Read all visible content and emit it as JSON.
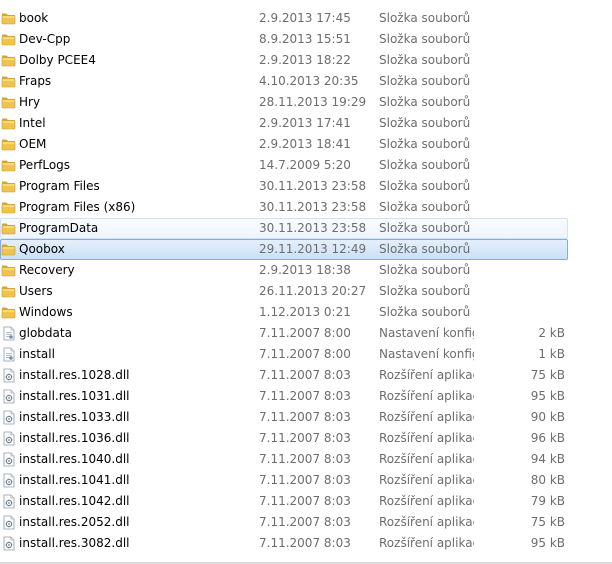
{
  "file_list": {
    "rows": [
      {
        "name": "book",
        "date": "2.9.2013 17:45",
        "type": "Složka souborů",
        "size": "",
        "icon": "folder-icon"
      },
      {
        "name": "Dev-Cpp",
        "date": "8.9.2013 15:51",
        "type": "Složka souborů",
        "size": "",
        "icon": "folder-icon"
      },
      {
        "name": "Dolby PCEE4",
        "date": "2.9.2013 18:22",
        "type": "Složka souborů",
        "size": "",
        "icon": "folder-icon"
      },
      {
        "name": "Fraps",
        "date": "4.10.2013 20:35",
        "type": "Složka souborů",
        "size": "",
        "icon": "folder-icon"
      },
      {
        "name": "Hry",
        "date": "28.11.2013 19:29",
        "type": "Složka souborů",
        "size": "",
        "icon": "folder-icon"
      },
      {
        "name": "Intel",
        "date": "2.9.2013 17:41",
        "type": "Složka souborů",
        "size": "",
        "icon": "folder-icon"
      },
      {
        "name": "OEM",
        "date": "2.9.2013 18:41",
        "type": "Složka souborů",
        "size": "",
        "icon": "folder-icon"
      },
      {
        "name": "PerfLogs",
        "date": "14.7.2009 5:20",
        "type": "Složka souborů",
        "size": "",
        "icon": "folder-icon"
      },
      {
        "name": "Program Files",
        "date": "30.11.2013 23:58",
        "type": "Složka souborů",
        "size": "",
        "icon": "folder-icon"
      },
      {
        "name": "Program Files (x86)",
        "date": "30.11.2013 23:58",
        "type": "Složka souborů",
        "size": "",
        "icon": "folder-icon"
      },
      {
        "name": "ProgramData",
        "date": "30.11.2013 23:58",
        "type": "Složka souborů",
        "size": "",
        "icon": "folder-icon",
        "state": "hover"
      },
      {
        "name": "Qoobox",
        "date": "29.11.2013 12:49",
        "type": "Složka souborů",
        "size": "",
        "icon": "folder-icon",
        "state": "selected"
      },
      {
        "name": "Recovery",
        "date": "2.9.2013 18:38",
        "type": "Složka souborů",
        "size": "",
        "icon": "folder-icon"
      },
      {
        "name": "Users",
        "date": "26.11.2013 20:27",
        "type": "Složka souborů",
        "size": "",
        "icon": "folder-icon"
      },
      {
        "name": "Windows",
        "date": "1.12.2013 0:21",
        "type": "Složka souborů",
        "size": "",
        "icon": "folder-icon"
      },
      {
        "name": "globdata",
        "date": "7.11.2007 8:00",
        "type": "Nastavení konfigu...",
        "size": "2 kB",
        "icon": "config-file-icon"
      },
      {
        "name": "install",
        "date": "7.11.2007 8:00",
        "type": "Nastavení konfigu...",
        "size": "1 kB",
        "icon": "config-file-icon"
      },
      {
        "name": "install.res.1028.dll",
        "date": "7.11.2007 8:03",
        "type": "Rozšíření aplikace",
        "size": "75 kB",
        "icon": "dll-file-icon"
      },
      {
        "name": "install.res.1031.dll",
        "date": "7.11.2007 8:03",
        "type": "Rozšíření aplikace",
        "size": "95 kB",
        "icon": "dll-file-icon"
      },
      {
        "name": "install.res.1033.dll",
        "date": "7.11.2007 8:03",
        "type": "Rozšíření aplikace",
        "size": "90 kB",
        "icon": "dll-file-icon"
      },
      {
        "name": "install.res.1036.dll",
        "date": "7.11.2007 8:03",
        "type": "Rozšíření aplikace",
        "size": "96 kB",
        "icon": "dll-file-icon"
      },
      {
        "name": "install.res.1040.dll",
        "date": "7.11.2007 8:03",
        "type": "Rozšíření aplikace",
        "size": "94 kB",
        "icon": "dll-file-icon"
      },
      {
        "name": "install.res.1041.dll",
        "date": "7.11.2007 8:03",
        "type": "Rozšíření aplikace",
        "size": "80 kB",
        "icon": "dll-file-icon"
      },
      {
        "name": "install.res.1042.dll",
        "date": "7.11.2007 8:03",
        "type": "Rozšíření aplikace",
        "size": "79 kB",
        "icon": "dll-file-icon"
      },
      {
        "name": "install.res.2052.dll",
        "date": "7.11.2007 8:03",
        "type": "Rozšíření aplikace",
        "size": "75 kB",
        "icon": "dll-file-icon"
      },
      {
        "name": "install.res.3082.dll",
        "date": "7.11.2007 8:03",
        "type": "Rozšíření aplikace",
        "size": "95 kB",
        "icon": "dll-file-icon"
      }
    ]
  },
  "colors": {
    "folder": "#f0c44c",
    "selected_border": "#84acdd",
    "hover_border": "#cfe3f8",
    "secondary_text": "#6d6d6d"
  }
}
